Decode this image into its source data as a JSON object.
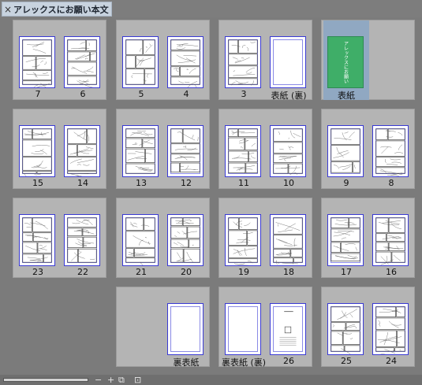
{
  "tab": {
    "title": "アレックスにお願い本文",
    "close": "×"
  },
  "cover": {
    "text": "アレックスにお願い"
  },
  "spreads": [
    {
      "pages": [
        {
          "label": "7",
          "kind": "manga"
        },
        {
          "label": "6",
          "kind": "manga"
        }
      ]
    },
    {
      "pages": [
        {
          "label": "5",
          "kind": "manga"
        },
        {
          "label": "4",
          "kind": "manga"
        }
      ]
    },
    {
      "pages": [
        {
          "label": "3",
          "kind": "manga"
        },
        {
          "label": "表紙 (裏)",
          "kind": "blank"
        }
      ]
    },
    {
      "pages": [
        {
          "label": "表紙",
          "kind": "cover",
          "selected": true
        }
      ]
    },
    {
      "pages": [
        {
          "label": "15",
          "kind": "manga"
        },
        {
          "label": "14",
          "kind": "manga"
        }
      ]
    },
    {
      "pages": [
        {
          "label": "13",
          "kind": "manga"
        },
        {
          "label": "12",
          "kind": "manga"
        }
      ]
    },
    {
      "pages": [
        {
          "label": "11",
          "kind": "manga"
        },
        {
          "label": "10",
          "kind": "manga"
        }
      ]
    },
    {
      "pages": [
        {
          "label": "9",
          "kind": "manga"
        },
        {
          "label": "8",
          "kind": "manga"
        }
      ]
    },
    {
      "pages": [
        {
          "label": "23",
          "kind": "manga"
        },
        {
          "label": "22",
          "kind": "manga"
        }
      ]
    },
    {
      "pages": [
        {
          "label": "21",
          "kind": "manga"
        },
        {
          "label": "20",
          "kind": "manga"
        }
      ]
    },
    {
      "pages": [
        {
          "label": "19",
          "kind": "manga"
        },
        {
          "label": "18",
          "kind": "manga"
        }
      ]
    },
    {
      "pages": [
        {
          "label": "17",
          "kind": "manga"
        },
        {
          "label": "16",
          "kind": "manga"
        }
      ]
    },
    {
      "pages": [
        {
          "label": "裏表紙",
          "kind": "blank"
        }
      ]
    },
    {
      "pages": [
        {
          "label": "裏表紙 (裏)",
          "kind": "blank"
        },
        {
          "label": "26",
          "kind": "text"
        }
      ]
    },
    {
      "pages": [
        {
          "label": "25",
          "kind": "manga"
        },
        {
          "label": "24",
          "kind": "manga"
        }
      ]
    }
  ],
  "bottombar": {
    "zoom_out": "−",
    "zoom_in": "+",
    "icon1": "fit-page-icon",
    "icon2": "page-settings-icon"
  }
}
